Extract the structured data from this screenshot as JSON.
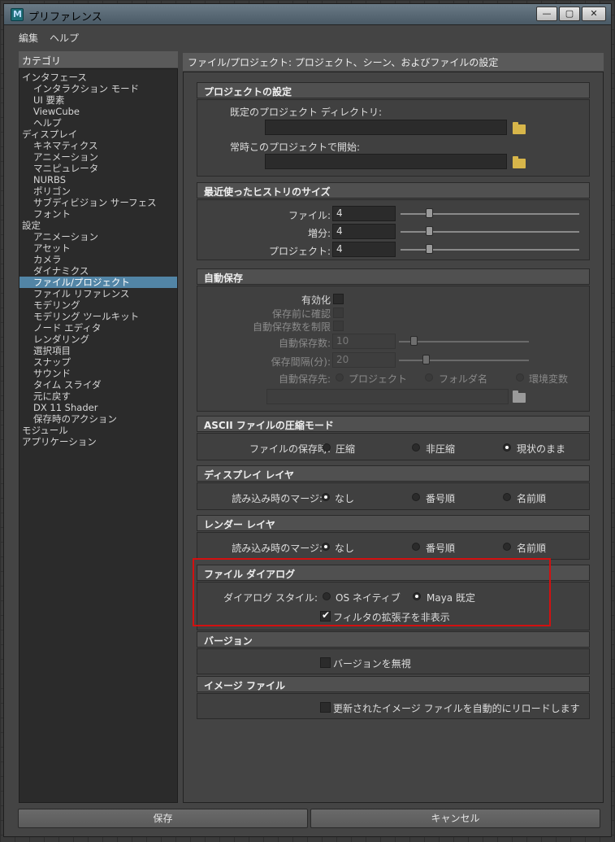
{
  "window": {
    "title": "プリファレンス"
  },
  "menu": [
    "編集",
    "ヘルプ"
  ],
  "categories": {
    "header": "カテゴリ",
    "items": [
      {
        "label": "インタフェース",
        "level": 0
      },
      {
        "label": "インタラクション モード",
        "level": 1
      },
      {
        "label": "UI 要素",
        "level": 1
      },
      {
        "label": "ViewCube",
        "level": 1
      },
      {
        "label": "ヘルプ",
        "level": 1
      },
      {
        "label": "ディスプレイ",
        "level": 0
      },
      {
        "label": "キネマティクス",
        "level": 1
      },
      {
        "label": "アニメーション",
        "level": 1
      },
      {
        "label": "マニピュレータ",
        "level": 1
      },
      {
        "label": "NURBS",
        "level": 1
      },
      {
        "label": "ポリゴン",
        "level": 1
      },
      {
        "label": "サブディビジョン サーフェス",
        "level": 1
      },
      {
        "label": "フォント",
        "level": 1
      },
      {
        "label": "設定",
        "level": 0
      },
      {
        "label": "アニメーション",
        "level": 1
      },
      {
        "label": "アセット",
        "level": 1
      },
      {
        "label": "カメラ",
        "level": 1
      },
      {
        "label": "ダイナミクス",
        "level": 1
      },
      {
        "label": "ファイル/プロジェクト",
        "level": 1,
        "selected": true
      },
      {
        "label": "ファイル リファレンス",
        "level": 1
      },
      {
        "label": "モデリング",
        "level": 1
      },
      {
        "label": "モデリング ツールキット",
        "level": 1
      },
      {
        "label": "ノード エディタ",
        "level": 1
      },
      {
        "label": "レンダリング",
        "level": 1
      },
      {
        "label": "選択項目",
        "level": 1
      },
      {
        "label": "スナップ",
        "level": 1
      },
      {
        "label": "サウンド",
        "level": 1
      },
      {
        "label": "タイム スライダ",
        "level": 1
      },
      {
        "label": "元に戻す",
        "level": 1
      },
      {
        "label": "DX 11 Shader",
        "level": 1
      },
      {
        "label": "保存時のアクション",
        "level": 1
      },
      {
        "label": "モジュール",
        "level": 0
      },
      {
        "label": "アプリケーション",
        "level": 0
      }
    ]
  },
  "main": {
    "header": "ファイル/プロジェクト: プロジェクト、シーン、およびファイルの設定",
    "project": {
      "title": "プロジェクトの設定",
      "default_dir_label": "既定のプロジェクト ディレクトリ:",
      "default_dir_value": "",
      "always_start_label": "常時このプロジェクトで開始:",
      "always_start_value": ""
    },
    "history": {
      "title": "最近使ったヒストリのサイズ",
      "rows": [
        {
          "label": "ファイル:",
          "value": "4"
        },
        {
          "label": "増分:",
          "value": "4"
        },
        {
          "label": "プロジェクト:",
          "value": "4"
        }
      ]
    },
    "autosave": {
      "title": "自動保存",
      "enable": "有効化",
      "prompt": "保存前に確認",
      "limit": "自動保存数を制限",
      "count_label": "自動保存数:",
      "count_value": "10",
      "interval_label": "保存間隔(分):",
      "interval_value": "20",
      "dest_label": "自動保存先:",
      "dest_options": [
        "プロジェクト",
        "フォルダ名",
        "環境変数"
      ],
      "path_value": ""
    },
    "ascii": {
      "title": "ASCII ファイルの圧縮モード",
      "label": "ファイルの保存時:",
      "options": [
        "圧縮",
        "非圧縮",
        "現状のまま"
      ],
      "selected": 2
    },
    "display_layers": {
      "title": "ディスプレイ レイヤ",
      "label": "読み込み時のマージ:",
      "options": [
        "なし",
        "番号順",
        "名前順"
      ],
      "selected": 0
    },
    "render_layers": {
      "title": "レンダー レイヤ",
      "label": "読み込み時のマージ:",
      "options": [
        "なし",
        "番号順",
        "名前順"
      ],
      "selected": 0
    },
    "file_dialog": {
      "title": "ファイル ダイアログ",
      "label": "ダイアログ スタイル:",
      "options": [
        "OS ネイティブ",
        "Maya 既定"
      ],
      "selected": 1,
      "hide_ext": "フィルタの拡張子を非表示",
      "hide_ext_checked": true
    },
    "version": {
      "title": "バージョン",
      "ignore": "バージョンを無視"
    },
    "image_files": {
      "title": "イメージ ファイル",
      "reload": "更新されたイメージ ファイルを自動的にリロードします"
    }
  },
  "buttons": {
    "save": "保存",
    "cancel": "キャンセル"
  },
  "colors": {
    "selection": "#5285a6",
    "highlight": "#d21010",
    "folder": "#d8b64a"
  }
}
